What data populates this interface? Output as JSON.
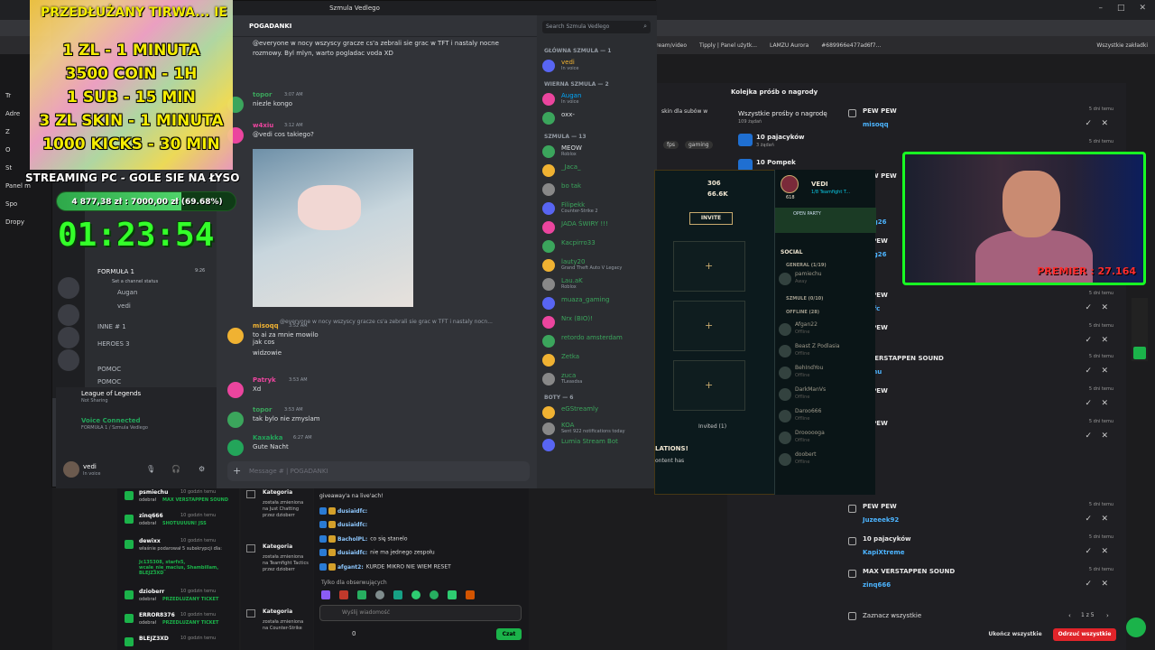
{
  "browser": {
    "bookmarks": [
      "edycja stream/video",
      "Tipply | Panel użytk...",
      "LAMZU Aurora",
      "#689966e477ad6f7..."
    ],
    "all_bookmarks": "Wszystkie zakładki"
  },
  "overlay": {
    "title": "PRZEDŁUŻANY TIRWA... IE",
    "lines": [
      "1 ZL - 1 MINUTA",
      "3500 COIN - 1H",
      "1 SUB - 15 MIN",
      "3 ZL SKIN - 1 MINUTA",
      "1000 KICKS - 30 MIN"
    ],
    "streaming": "STREAMING PC - GOLE SIE NA ŁYSO",
    "goal_text": "4 877,38 zł : 7000,00 zł (69.68%)",
    "goal_fraction": 0.6968,
    "timer": "01:23:54"
  },
  "discord": {
    "title": "Szmula Vedlego",
    "channel": "POGADANKI",
    "search_placeholder": "Search Szmula Vedlego",
    "input_placeholder": "Message # | POGADANKI",
    "pinned_text": "@everyone w nocy wszyscy gracze cs'a zebrali sie grac w TFT i nastaly nocne rozmowy. Byl mlyn, warto pogladac voda XD",
    "messages": [
      {
        "name": "topor",
        "time": "3:07 AM",
        "text": "niezle kongo",
        "color": "#3ba55c"
      },
      {
        "name": "w4xiu",
        "time": "3:12 AM",
        "text": "@vedi cos takiego?",
        "color": "#eb459e"
      },
      {
        "name": "misoqq",
        "time": "3:52 AM",
        "text": "to ai za mnie mowilo",
        "color": "#f0b232"
      },
      {
        "name": "",
        "time": "",
        "text": "jak cos",
        "color": "#dbdee1"
      },
      {
        "name": "",
        "time": "",
        "text": "widzowie",
        "color": "#dbdee1"
      },
      {
        "name": "Patryk",
        "time": "3:53 AM",
        "text": "Xd",
        "color": "#eb459e"
      },
      {
        "name": "topor",
        "time": "3:53 AM",
        "text": "tak bylo nie zmyslam",
        "color": "#3ba55c"
      },
      {
        "name": "Kaxakka",
        "time": "6:27 AM",
        "text": "Gute Nacht",
        "color": "#23a55a"
      }
    ],
    "reply_text": "@everyone w nocy wszyscy gracze cs'a zebrali sie grac w TFT i nastaly nocn...",
    "channels": [
      {
        "label": "FORMUŁA 1",
        "meta": "9:26"
      },
      {
        "label": "Set a channel status",
        "meta": ""
      },
      {
        "label": "Augan",
        "meta": ""
      },
      {
        "label": "vedi",
        "meta": ""
      },
      {
        "label": "INNE # 1",
        "meta": ""
      },
      {
        "label": "HEROES 3",
        "meta": ""
      },
      {
        "label": "POMOC",
        "meta": ""
      },
      {
        "label": "POMOC",
        "meta": ""
      }
    ],
    "activity": {
      "game": "League of Legends",
      "status": "Not Sharing"
    },
    "voice": {
      "title": "Voice Connected",
      "channel": "FORMUŁA 1 / Szmula Vedlego"
    },
    "user": {
      "name": "vedi",
      "status": "In voice"
    },
    "member_groups": [
      {
        "label": "GŁÓWNA SZMULA — 1",
        "members": [
          {
            "name": "vedi",
            "status": "In voice",
            "color": "#f0b232"
          }
        ]
      },
      {
        "label": "WIERNA SZMULA — 2",
        "members": [
          {
            "name": "Augan",
            "status": "In voice",
            "color": "#00a8fc"
          },
          {
            "name": "oxx-",
            "status": "",
            "color": "#dbdee1"
          }
        ]
      },
      {
        "label": "SZMULA — 13",
        "members": [
          {
            "name": "MEOW",
            "status": "Roblox",
            "color": "#dbdee1"
          },
          {
            "name": "_Jaca_",
            "status": "",
            "color": "#3ba55c"
          },
          {
            "name": "bo tak",
            "status": "",
            "color": "#3ba55c"
          },
          {
            "name": "Filipekk",
            "status": "Counter-Strike 2",
            "color": "#3ba55c"
          },
          {
            "name": "JADA ŚWIRY !!!",
            "status": "",
            "color": "#3ba55c"
          },
          {
            "name": "Kacpirro33",
            "status": "",
            "color": "#3ba55c"
          },
          {
            "name": "lauty20",
            "status": "Grand Theft Auto V Legacy",
            "color": "#3ba55c"
          },
          {
            "name": "Lau.aK",
            "status": "Roblox",
            "color": "#3ba55c"
          },
          {
            "name": "muaza_gaming",
            "status": "",
            "color": "#3ba55c"
          },
          {
            "name": "Nrx (BIO)!",
            "status": "",
            "color": "#3ba55c"
          },
          {
            "name": "retordo amsterdam",
            "status": "",
            "color": "#3ba55c"
          },
          {
            "name": "Zetka",
            "status": "",
            "color": "#3ba55c"
          },
          {
            "name": "zuca",
            "status": "TLeasdsa",
            "color": "#3ba55c"
          }
        ]
      },
      {
        "label": "BOTY — 6",
        "members": [
          {
            "name": "eGStreamly",
            "status": "",
            "color": "#3ba55c"
          },
          {
            "name": "KOA",
            "status": "Sent 922 notifications today",
            "color": "#3ba55c"
          },
          {
            "name": "Lumia Stream Bot",
            "status": "",
            "color": "#3ba55c"
          }
        ]
      }
    ]
  },
  "lol": {
    "currency1": "306",
    "currency2": "66.6K",
    "player": "VEDI",
    "level": "618",
    "status": "1/8 Teamfight T...",
    "invite": "INVITE",
    "open_party": "OPEN PARTY",
    "social": "SOCIAL",
    "general": "GENERAL (1/19)",
    "szmule": "SZMULE (0/10)",
    "offline": "OFFLINE (28)",
    "friends": [
      {
        "name": "pamiechu",
        "status": "Away"
      },
      {
        "name": "Afgan22",
        "status": "Offline"
      },
      {
        "name": "Beast Z Podlasia",
        "status": "Offline"
      },
      {
        "name": "BehIndYou",
        "status": "Offline"
      },
      {
        "name": "DarkManVs",
        "status": "Offline"
      },
      {
        "name": "Daroo666",
        "status": "Offline"
      },
      {
        "name": "Droooooga",
        "status": "Offline"
      },
      {
        "name": "doobert",
        "status": "Offline"
      }
    ],
    "invited": "Invited (1)",
    "notice": "LATIONS!",
    "notice2": "ontent has"
  },
  "queue": {
    "title": "Kolejka próśb o nagrody",
    "all_label": "Wszystkie prośby o nagrodę",
    "count": "109 żądań",
    "rewards": [
      {
        "name": "10 pajacyków",
        "count": "3 żądań"
      },
      {
        "name": "10 Pompek",
        "count": ""
      }
    ],
    "left_text": "skin dla subów w",
    "tags": [
      "fps",
      "gaming"
    ],
    "rows": [
      {
        "title": "PEW PEW",
        "user": "misoqq",
        "time": "5 dni temu"
      },
      {
        "title": "",
        "user": "",
        "time": "5 dni temu"
      },
      {
        "title": "PEW PEW",
        "user": "",
        "time": "5 dni temu"
      },
      {
        "title": "",
        "user": "Mag26",
        "time": "5 dni temu"
      },
      {
        "title": "W PEW",
        "user": "Mag26",
        "time": "5 dni temu"
      },
      {
        "title": "W PEW",
        "user": "aidfc",
        "time": "5 dni temu"
      },
      {
        "title": "W PEW",
        "user": "in",
        "time": "5 dni temu"
      },
      {
        "title": "X VERSTAPPEN SOUND",
        "user": "iechu",
        "time": "5 dni temu"
      },
      {
        "title": "W PEW",
        "user": "in",
        "time": "5 dni temu"
      },
      {
        "title": "W PEW",
        "user": "in",
        "time": "5 dni temu"
      },
      {
        "title": "PEW PEW",
        "user": "Juzeeek92",
        "time": "5 dni temu"
      },
      {
        "title": "10 pajacyków",
        "user": "KapiXtreme",
        "time": "5 dni temu"
      },
      {
        "title": "MAX VERSTAPPEN SOUND",
        "user": "zinq666",
        "time": "5 dni temu"
      }
    ],
    "select_all": "Zaznacz wszystkie",
    "page": "1 z 5",
    "complete_all": "Ukończ wszystkie",
    "reject_all": "Odrzuć wszystkie"
  },
  "cam": {
    "label": "PREMIER : 27.164"
  },
  "events": [
    {
      "user": "psmiechu",
      "action": "odebrał",
      "item": "MAX VERSTAPPEN SOUND",
      "time": "10 godzin temu"
    },
    {
      "user": "zinq666",
      "action": "odebrał",
      "item": "SHOTUUUUN! JSS",
      "time": "10 godzin temu"
    },
    {
      "user": "dewixx",
      "action": "właśnie podarował 5 subskrypcji dla:",
      "item": "Jc135308, starfx5, wcale_nie_macius, Shambillam, BLEJZ3XD",
      "time": "10 godzin temu"
    },
    {
      "user": "dzioberr",
      "action": "odebrał",
      "item": "PRZEDLUZANY TICKET",
      "time": "10 godzin temu"
    },
    {
      "user": "ERROR8376",
      "action": "odebrał",
      "item": "PRZEDLUZANY TICKET",
      "time": "10 godzin temu"
    },
    {
      "user": "BLEJZ3XD",
      "action": "",
      "item": "",
      "time": "10 godzin temu"
    }
  ],
  "category": [
    {
      "title": "Kategoria",
      "body": "została zmieniona na Just Chatting przez dzioberr"
    },
    {
      "title": "Kategoria",
      "body": "została zmieniona na Teamfight Tactics przez dzioberr"
    },
    {
      "title": "Kategoria",
      "body": "została zmieniona na Counter-Strike"
    }
  ],
  "chat": {
    "lines": [
      {
        "user": "",
        "text": "giveaway'a na live'ach!"
      },
      {
        "user": "dusiaidfc:",
        "text": ""
      },
      {
        "user": "dusiaidfc:",
        "text": ""
      },
      {
        "user": "BacholPL:",
        "text": "co się stanelo"
      },
      {
        "user": "dusiaidfc:",
        "text": "nie ma jednego zespołu"
      },
      {
        "user": "afgant2:",
        "text": "KURDE MIKRO NIE WIEM RESET"
      }
    ],
    "followers": "Tylko dla obserwujących",
    "placeholder": "Wyślij wiadomość",
    "send": "Czat",
    "points": "0"
  },
  "dash": {
    "items": [
      "Tr",
      "Adre",
      "Z",
      "O",
      "St",
      "Panel m",
      "Spo",
      "Dropy"
    ]
  }
}
